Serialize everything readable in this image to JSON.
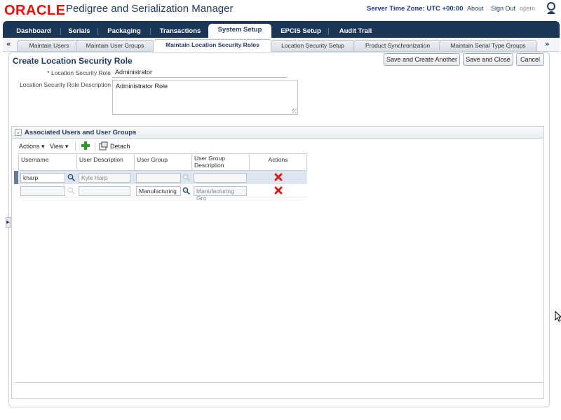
{
  "header": {
    "logo": "ORACLE",
    "app_title": "Pedigree and Serialization Manager",
    "server_time": "Server Time Zone: UTC +00:00",
    "links": [
      "About",
      "Sign Out",
      "opsm"
    ]
  },
  "main_tabs": [
    "Dashboard",
    "Serials",
    "Packaging",
    "Transactions",
    "System Setup",
    "EPCIS Setup",
    "Audit Trail"
  ],
  "main_tabs_active": "System Setup",
  "sub_tabs": [
    "Maintain Users",
    "Maintain User Groups",
    "Maintain Location Security Roles",
    "Location Security Setup",
    "Product Synchronization",
    "Maintain Serial Type Groups"
  ],
  "sub_tabs_active": "Maintain Location Security Roles",
  "sub_scroll": {
    "left": "«",
    "right": "»"
  },
  "page": {
    "title": "Create Location Security Role",
    "buttons": {
      "save_another": "Save and Create Another",
      "save_close": "Save and Close",
      "cancel": "Cancel"
    },
    "fields": {
      "role_label_req": "*",
      "role_label": "Location Security Role",
      "role_value": "Administrator",
      "desc_label": "Location Security Role Description",
      "desc_value": "Administrator Role"
    }
  },
  "section": {
    "title": "Associated Users and User Groups",
    "toolbar": {
      "actions": "Actions ▾",
      "view": "View ▾",
      "detach": "Detach"
    },
    "columns": [
      "Username",
      "User Description",
      "User Group",
      "User Group Description",
      "Actions"
    ],
    "rows": [
      {
        "username": "kharp",
        "user_description": "Kyle Harp",
        "user_group": "",
        "user_group_description": ""
      },
      {
        "username": "",
        "user_description": "",
        "user_group": "Manufacturing",
        "user_group_description": "Manufacturing Gro"
      }
    ]
  },
  "colors": {
    "brand_red": "#e3120b",
    "nav_blue": "#1b3657",
    "title_blue": "#1d3a5f",
    "delete_red": "#d0231b",
    "add_green": "#2e9a2e"
  }
}
